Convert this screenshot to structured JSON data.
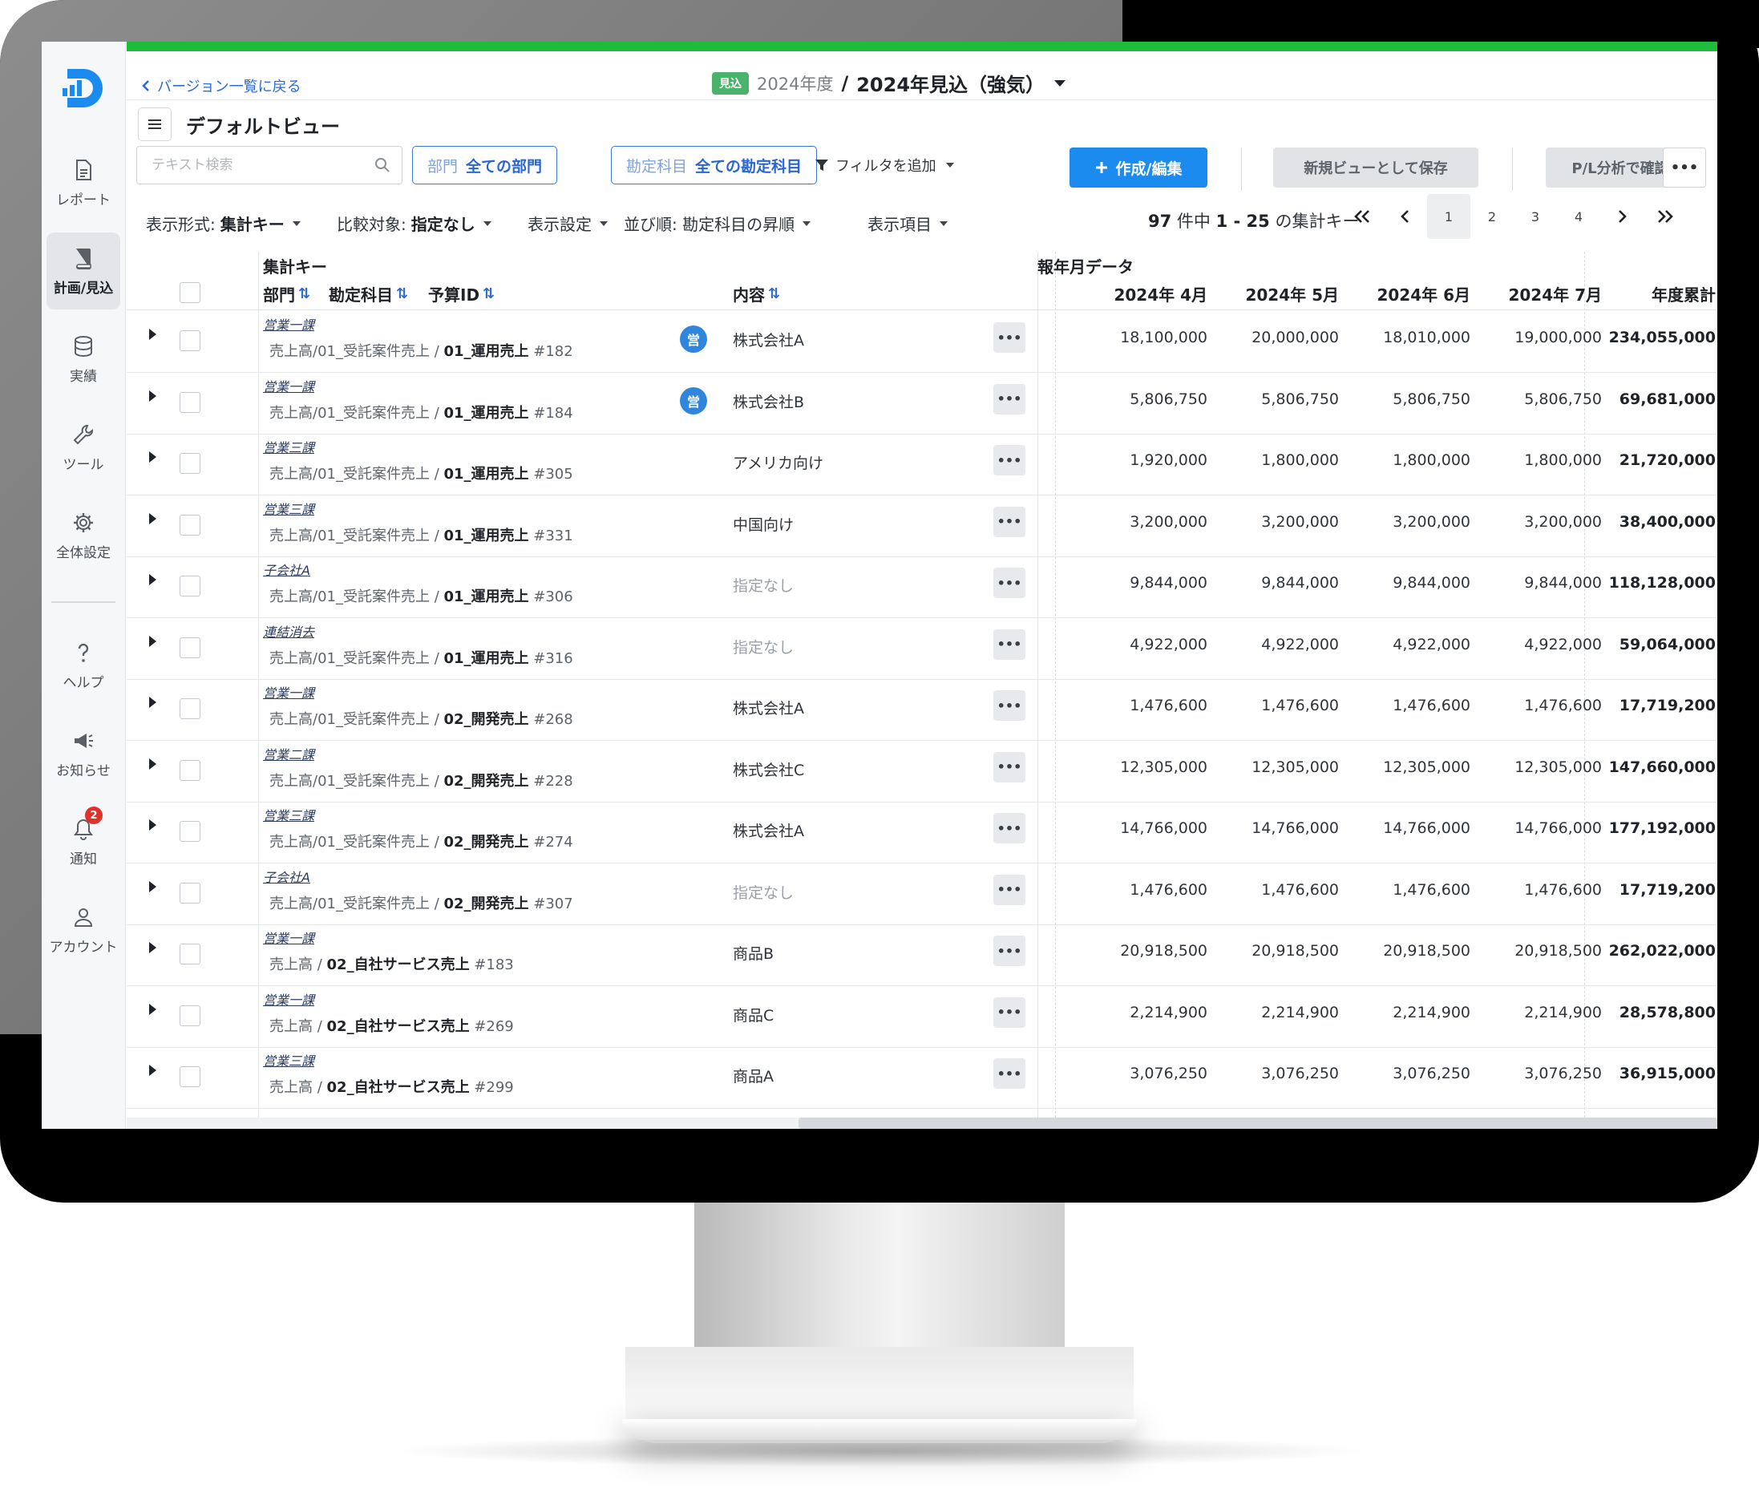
{
  "app": {
    "nav": [
      {
        "label": "レポート",
        "icon": "document-icon"
      },
      {
        "label": "計画/見込",
        "icon": "book-icon",
        "active": true
      },
      {
        "label": "実績",
        "icon": "database-icon"
      },
      {
        "label": "ツール",
        "icon": "wrench-icon"
      },
      {
        "label": "全体設定",
        "icon": "gear-icon"
      },
      {
        "label": "ヘルプ",
        "icon": "help-icon"
      },
      {
        "label": "お知らせ",
        "icon": "megaphone-icon"
      },
      {
        "label": "通知",
        "icon": "bell-icon",
        "badge": "2"
      },
      {
        "label": "アカウント",
        "icon": "user-icon"
      }
    ],
    "accent_color": "#1b8bf0",
    "top_bar_color": "#1fbb3c"
  },
  "header": {
    "back_label": "バージョン一覧に戻る",
    "badge": "見込",
    "fiscal_year": "2024年度",
    "separator": "/",
    "version_name": "2024年見込（強気）"
  },
  "view": {
    "title": "デフォルトビュー"
  },
  "filters": {
    "search_placeholder": "テキスト検索",
    "dept_key": "部門",
    "dept_value": "全ての部門",
    "account_key": "勘定科目",
    "account_value": "全ての勘定科目",
    "add_filter": "フィルタを追加"
  },
  "actions": {
    "create_edit": "作成/編集",
    "save_as_new_view": "新規ビューとして保存",
    "pl_analysis": "P/L分析で確認",
    "more": "•••"
  },
  "display": {
    "format_label": "表示形式: ",
    "format_value": "集計キー",
    "compare_label": "比較対象: ",
    "compare_value": "指定なし",
    "settings": "表示設定",
    "order_label": "並び順: 勘定科目の昇順",
    "columns": "表示項目"
  },
  "pagination": {
    "total": "97",
    "count_mid": " 件中 ",
    "range": "1 - 25",
    "count_suffix": " の集計キー",
    "pages": [
      "1",
      "2",
      "3",
      "4"
    ],
    "current": "1"
  },
  "table": {
    "group_key": "集計キー",
    "group_monthly": "報年月データ",
    "col_dept": "部門",
    "col_account": "勘定科目",
    "col_budget_id": "予算ID",
    "col_content": "内容",
    "months": [
      "2024年 4月",
      "2024年 5月",
      "2024年 6月",
      "2024年 7月"
    ],
    "col_total": "年度累計",
    "rows": [
      {
        "dept": "営業一課",
        "path": "売上高/01_受託案件売上 / ",
        "account": "01_運用売上",
        "id": " #182",
        "tag": "営",
        "content": "株式会社A",
        "values": [
          "18,100,000",
          "20,000,000",
          "18,010,000",
          "19,000,000"
        ],
        "total": "234,055,000"
      },
      {
        "dept": "営業一課",
        "path": "売上高/01_受託案件売上 / ",
        "account": "01_運用売上",
        "id": " #184",
        "tag": "営",
        "content": "株式会社B",
        "values": [
          "5,806,750",
          "5,806,750",
          "5,806,750",
          "5,806,750"
        ],
        "total": "69,681,000"
      },
      {
        "dept": "営業三課",
        "path": "売上高/01_受託案件売上 / ",
        "account": "01_運用売上",
        "id": " #305",
        "tag": "",
        "content": "アメリカ向け",
        "values": [
          "1,920,000",
          "1,800,000",
          "1,800,000",
          "1,800,000"
        ],
        "total": "21,720,000"
      },
      {
        "dept": "営業三課",
        "path": "売上高/01_受託案件売上 / ",
        "account": "01_運用売上",
        "id": " #331",
        "tag": "",
        "content": "中国向け",
        "values": [
          "3,200,000",
          "3,200,000",
          "3,200,000",
          "3,200,000"
        ],
        "total": "38,400,000"
      },
      {
        "dept": "子会社A",
        "path": "売上高/01_受託案件売上 / ",
        "account": "01_運用売上",
        "id": " #306",
        "tag": "",
        "content": "指定なし",
        "values": [
          "9,844,000",
          "9,844,000",
          "9,844,000",
          "9,844,000"
        ],
        "total": "118,128,000"
      },
      {
        "dept": "連結消去",
        "path": "売上高/01_受託案件売上 / ",
        "account": "01_運用売上",
        "id": " #316",
        "tag": "",
        "content": "指定なし",
        "values": [
          "4,922,000",
          "4,922,000",
          "4,922,000",
          "4,922,000"
        ],
        "total": "59,064,000"
      },
      {
        "dept": "営業一課",
        "path": "売上高/01_受託案件売上 / ",
        "account": "02_開発売上",
        "id": " #268",
        "tag": "",
        "content": "株式会社A",
        "values": [
          "1,476,600",
          "1,476,600",
          "1,476,600",
          "1,476,600"
        ],
        "total": "17,719,200"
      },
      {
        "dept": "営業二課",
        "path": "売上高/01_受託案件売上 / ",
        "account": "02_開発売上",
        "id": " #228",
        "tag": "",
        "content": "株式会社C",
        "values": [
          "12,305,000",
          "12,305,000",
          "12,305,000",
          "12,305,000"
        ],
        "total": "147,660,000"
      },
      {
        "dept": "営業三課",
        "path": "売上高/01_受託案件売上 / ",
        "account": "02_開発売上",
        "id": " #274",
        "tag": "",
        "content": "株式会社A",
        "values": [
          "14,766,000",
          "14,766,000",
          "14,766,000",
          "14,766,000"
        ],
        "total": "177,192,000"
      },
      {
        "dept": "子会社A",
        "path": "売上高/01_受託案件売上 / ",
        "account": "02_開発売上",
        "id": " #307",
        "tag": "",
        "content": "指定なし",
        "values": [
          "1,476,600",
          "1,476,600",
          "1,476,600",
          "1,476,600"
        ],
        "total": "17,719,200"
      },
      {
        "dept": "営業一課",
        "path": "売上高 / ",
        "account": "02_自社サービス売上",
        "id": " #183",
        "tag": "",
        "content": "商品B",
        "values": [
          "20,918,500",
          "20,918,500",
          "20,918,500",
          "20,918,500"
        ],
        "total": "262,022,000"
      },
      {
        "dept": "営業一課",
        "path": "売上高 / ",
        "account": "02_自社サービス売上",
        "id": " #269",
        "tag": "",
        "content": "商品C",
        "values": [
          "2,214,900",
          "2,214,900",
          "2,214,900",
          "2,214,900"
        ],
        "total": "28,578,800"
      },
      {
        "dept": "営業三課",
        "path": "売上高 / ",
        "account": "02_自社サービス売上",
        "id": " #299",
        "tag": "",
        "content": "商品A",
        "values": [
          "3,076,250",
          "3,076,250",
          "3,076,250",
          "3,076,250"
        ],
        "total": "36,915,000"
      }
    ]
  }
}
